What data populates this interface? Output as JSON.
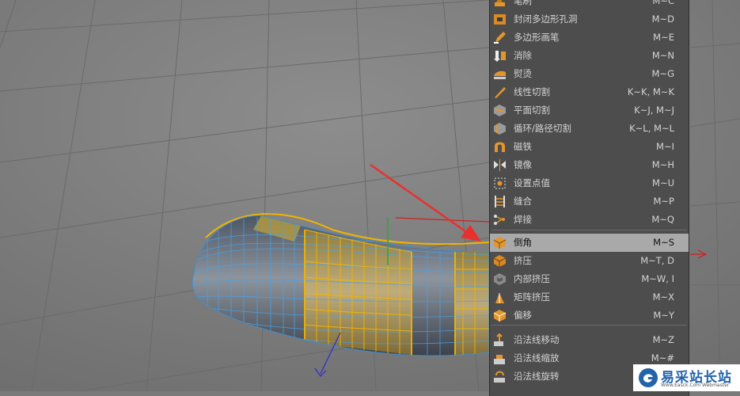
{
  "menu": {
    "items": [
      {
        "label": "笔刷",
        "shortcut": "M~C",
        "icon": "brush-icon"
      },
      {
        "label": "封闭多边形孔洞",
        "shortcut": "M~D",
        "icon": "close-polygon-hole-icon"
      },
      {
        "label": "多边形画笔",
        "shortcut": "M~E",
        "icon": "polygon-pen-icon"
      },
      {
        "label": "消除",
        "shortcut": "M~N",
        "icon": "dissolve-icon"
      },
      {
        "label": "熨烫",
        "shortcut": "M~G",
        "icon": "iron-icon"
      },
      {
        "label": "线性切割",
        "shortcut": "K~K, M~K",
        "icon": "line-cut-icon"
      },
      {
        "label": "平面切割",
        "shortcut": "K~J, M~J",
        "icon": "plane-cut-icon"
      },
      {
        "label": "循环/路径切割",
        "shortcut": "K~L, M~L",
        "icon": "loop-cut-icon"
      },
      {
        "label": "磁铁",
        "shortcut": "M~I",
        "icon": "magnet-icon"
      },
      {
        "label": "镜像",
        "shortcut": "M~H",
        "icon": "mirror-icon"
      },
      {
        "label": "设置点值",
        "shortcut": "M~U",
        "icon": "set-point-value-icon"
      },
      {
        "label": "缝合",
        "shortcut": "M~P",
        "icon": "stitch-icon"
      },
      {
        "label": "焊接",
        "shortcut": "M~Q",
        "icon": "weld-icon"
      },
      {
        "label": "倒角",
        "shortcut": "M~S",
        "icon": "bevel-icon",
        "selected": true
      },
      {
        "label": "挤压",
        "shortcut": "M~T, D",
        "icon": "extrude-icon"
      },
      {
        "label": "内部挤压",
        "shortcut": "M~W, I",
        "icon": "extrude-inner-icon"
      },
      {
        "label": "矩阵挤压",
        "shortcut": "M~X",
        "icon": "matrix-extrude-icon"
      },
      {
        "label": "偏移",
        "shortcut": "M~Y",
        "icon": "offset-icon"
      },
      {
        "label": "沿法线移动",
        "shortcut": "M~Z",
        "icon": "normal-move-icon"
      },
      {
        "label": "沿法线缩放",
        "shortcut": "M~#",
        "icon": "normal-scale-icon"
      },
      {
        "label": "沿法线旋转",
        "shortcut": "",
        "icon": "normal-rotate-icon"
      }
    ]
  },
  "watermark": {
    "title": "易采站长站",
    "subtitle": "Www.Easck.Com  Webmaster"
  },
  "colors": {
    "viewport_bg": "#7a7a7a",
    "menu_bg": "#4d4d4d",
    "selected_bg": "#a9a9a9",
    "selection_yellow": "#e8b400",
    "wire_blue": "#4aa2e8",
    "arrow_red": "#e8312f",
    "icon_orange": "#e3962c"
  }
}
